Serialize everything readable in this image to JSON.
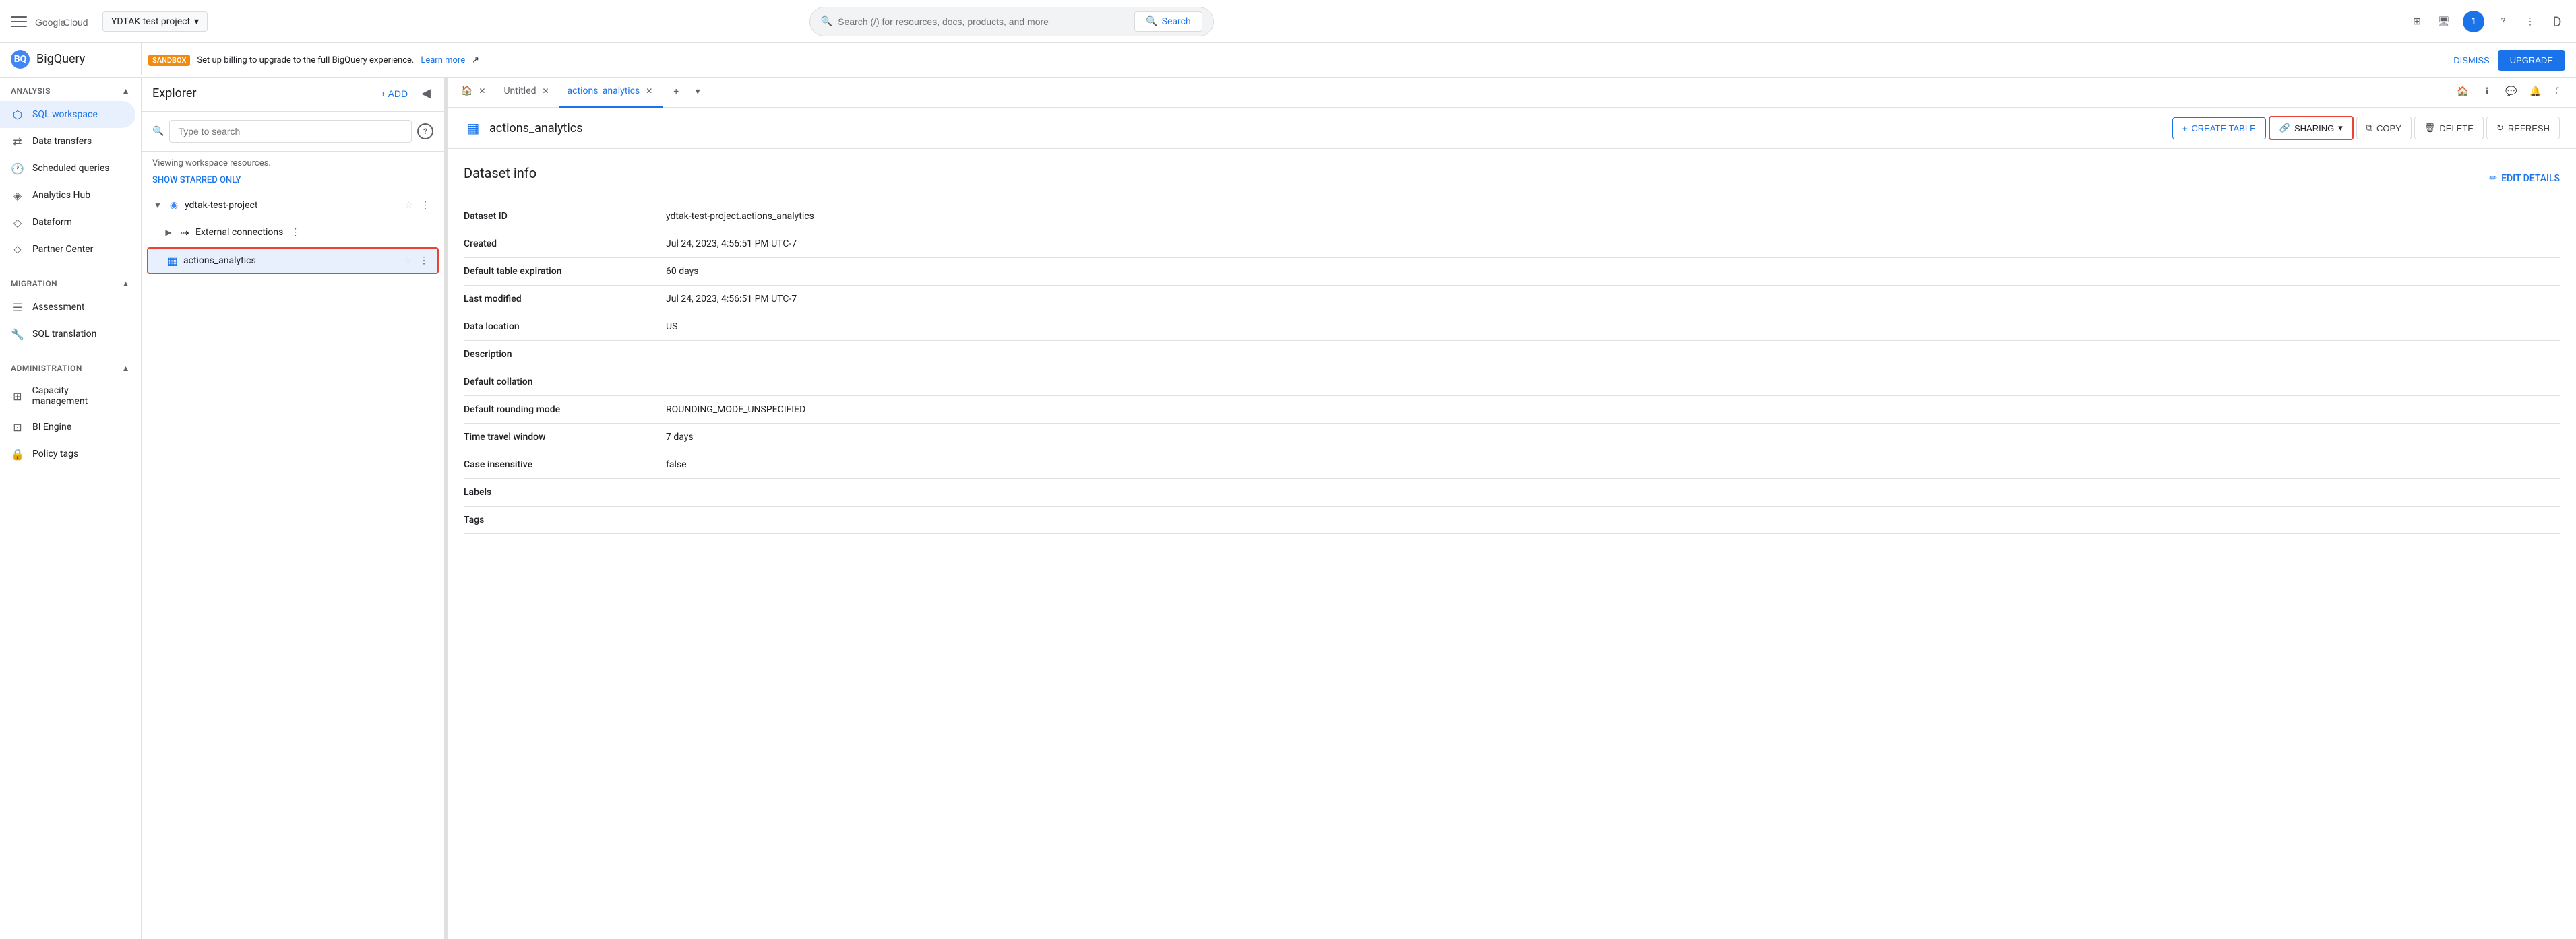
{
  "header": {
    "hamburger_label": "Menu",
    "project_selector": "YDTAK test project",
    "search_placeholder": "Search (/) for resources, docs, products, and more",
    "search_button_label": "Search",
    "avatar_letter": "1"
  },
  "sandbox_bar": {
    "badge": "SANDBOX",
    "message": "Set up billing to upgrade to the full BigQuery experience.",
    "link_text": "Learn more",
    "dismiss_label": "DISMISS",
    "upgrade_label": "UPGRADE"
  },
  "bigquery": {
    "title": "BigQuery"
  },
  "sidebar": {
    "analysis_section": "Analysis",
    "items_analysis": [
      {
        "id": "sql-workspace",
        "label": "SQL workspace",
        "icon": "⬡",
        "active": true
      },
      {
        "id": "data-transfers",
        "label": "Data transfers",
        "icon": "⇄"
      },
      {
        "id": "scheduled-queries",
        "label": "Scheduled queries",
        "icon": "🕐"
      },
      {
        "id": "analytics-hub",
        "label": "Analytics Hub",
        "icon": "◈"
      },
      {
        "id": "dataform",
        "label": "Dataform",
        "icon": "◇"
      },
      {
        "id": "partner-center",
        "label": "Partner Center",
        "icon": "⬦"
      }
    ],
    "migration_section": "Migration",
    "items_migration": [
      {
        "id": "assessment",
        "label": "Assessment",
        "icon": "☰"
      },
      {
        "id": "sql-translation",
        "label": "SQL translation",
        "icon": "🔧"
      }
    ],
    "administration_section": "Administration",
    "items_administration": [
      {
        "id": "capacity-management",
        "label": "Capacity management",
        "icon": "⊞"
      },
      {
        "id": "bi-engine",
        "label": "BI Engine",
        "icon": "⊡"
      },
      {
        "id": "policy-tags",
        "label": "Policy tags",
        "icon": "🔒"
      }
    ]
  },
  "explorer": {
    "title": "Explorer",
    "add_label": "+ ADD",
    "search_placeholder": "Type to search",
    "workspace_label": "Viewing workspace resources.",
    "show_starred_label": "SHOW STARRED ONLY",
    "project_name": "ydtak-test-project",
    "external_connections_label": "External connections",
    "dataset_label": "actions_analytics"
  },
  "tabs": [
    {
      "id": "home",
      "label": "🏠",
      "type": "home"
    },
    {
      "id": "untitled",
      "label": "Untitled",
      "closeable": true
    },
    {
      "id": "actions-analytics",
      "label": "actions_analytics",
      "closeable": true,
      "active": true
    }
  ],
  "dataset": {
    "icon": "▦",
    "title": "actions_analytics",
    "toolbar": {
      "create_table_label": "CREATE TABLE",
      "sharing_label": "SHARING",
      "copy_label": "COPY",
      "delete_label": "DELETE",
      "refresh_label": "REFRESH"
    },
    "info": {
      "section_title": "Dataset info",
      "edit_details_label": "EDIT DETAILS",
      "rows": [
        {
          "label": "Dataset ID",
          "value": "ydtak-test-project.actions_analytics"
        },
        {
          "label": "Created",
          "value": "Jul 24, 2023, 4:56:51 PM UTC-7"
        },
        {
          "label": "Default table expiration",
          "value": "60 days"
        },
        {
          "label": "Last modified",
          "value": "Jul 24, 2023, 4:56:51 PM UTC-7"
        },
        {
          "label": "Data location",
          "value": "US"
        },
        {
          "label": "Description",
          "value": ""
        },
        {
          "label": "Default collation",
          "value": ""
        },
        {
          "label": "Default rounding mode",
          "value": "ROUNDING_MODE_UNSPECIFIED"
        },
        {
          "label": "Time travel window",
          "value": "7 days"
        },
        {
          "label": "Case insensitive",
          "value": "false"
        },
        {
          "label": "Labels",
          "value": ""
        },
        {
          "label": "Tags",
          "value": ""
        }
      ]
    }
  }
}
